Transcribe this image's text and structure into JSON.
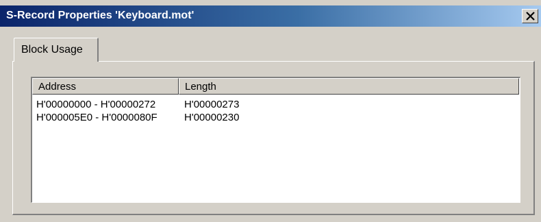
{
  "window": {
    "title": "S-Record Properties 'Keyboard.mot'",
    "close_icon": "close-icon"
  },
  "tabs": [
    {
      "label": "Block Usage",
      "selected": true
    }
  ],
  "table": {
    "columns": [
      "Address",
      "Length"
    ],
    "rows": [
      {
        "address": "H'00000000 - H'00000272",
        "length": "H'00000273"
      },
      {
        "address": "H'000005E0 - H'0000080F",
        "length": "H'00000230"
      }
    ]
  },
  "colors": {
    "titlebar_start": "#0a246a",
    "titlebar_end": "#a6caf0",
    "face": "#d4d0c8"
  }
}
